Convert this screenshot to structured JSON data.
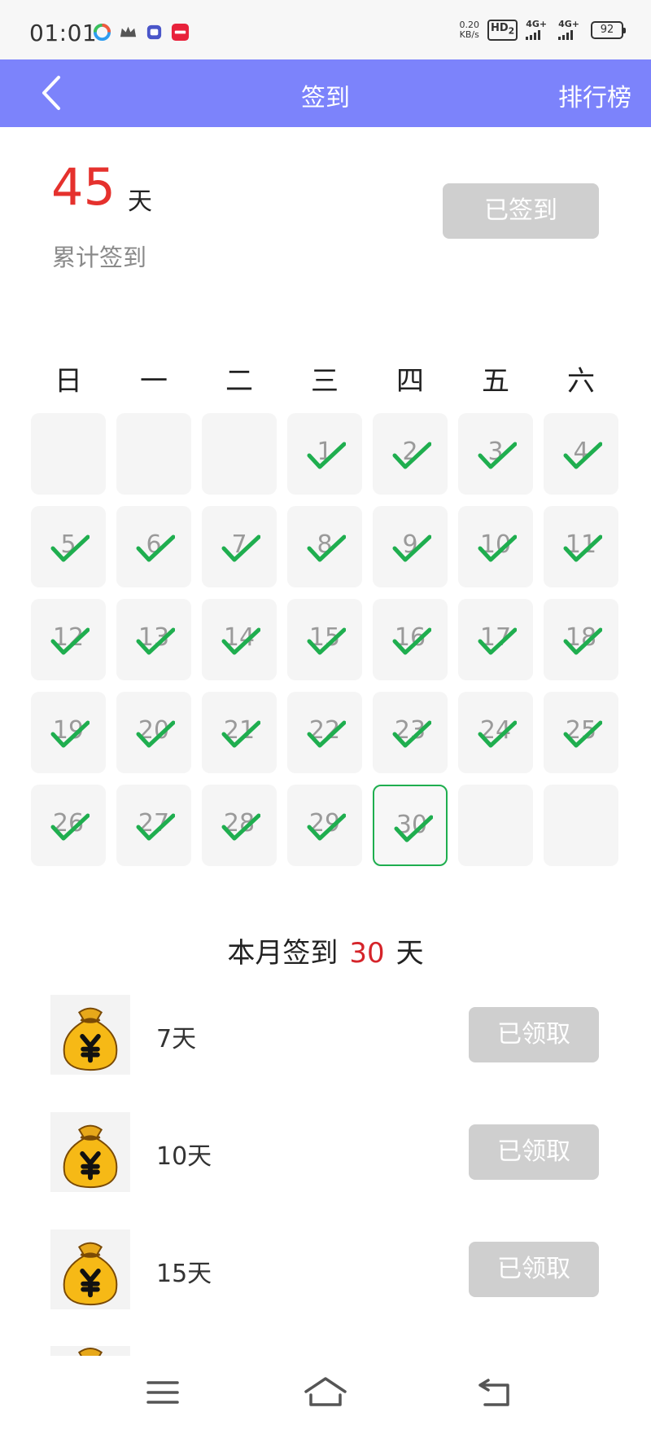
{
  "status_bar": {
    "time": "01:01",
    "net_speed": "0.20",
    "net_speed_unit": "KB/s",
    "hd": "HD",
    "hd_sub": "2",
    "sim1": "4G+",
    "sim2": "4G+",
    "battery": "92"
  },
  "nav": {
    "title": "签到",
    "right_label": "排行榜"
  },
  "summary": {
    "total_days": "45",
    "total_unit": "天",
    "total_label": "累计签到",
    "signed_button": "已签到"
  },
  "calendar": {
    "weekdays": [
      "日",
      "一",
      "二",
      "三",
      "四",
      "五",
      "六"
    ],
    "rows": [
      [
        null,
        null,
        null,
        1,
        2,
        3,
        4
      ],
      [
        5,
        6,
        7,
        8,
        9,
        10,
        11
      ],
      [
        12,
        13,
        14,
        15,
        16,
        17,
        18
      ],
      [
        19,
        20,
        21,
        22,
        23,
        24,
        25
      ],
      [
        26,
        27,
        28,
        29,
        30,
        null,
        null
      ]
    ],
    "checked_through": 30,
    "today": 30,
    "check_color": "#1fae4f"
  },
  "month": {
    "prefix": "本月签到",
    "count": "30",
    "suffix": "天"
  },
  "rewards": [
    {
      "label": "7天",
      "button": "已领取"
    },
    {
      "label": "10天",
      "button": "已领取"
    },
    {
      "label": "15天",
      "button": "已领取"
    }
  ],
  "colors": {
    "nav_bg": "#7c83fb",
    "accent_red": "#e5312d",
    "disabled_button": "#cfcfcf"
  }
}
